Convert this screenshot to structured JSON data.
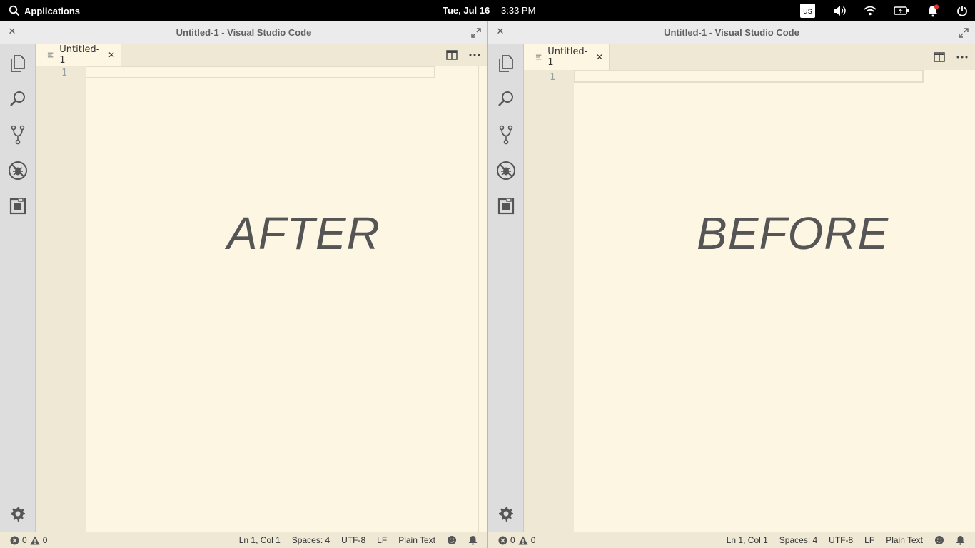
{
  "topbar": {
    "apps_label": "Applications",
    "date": "Tue, Jul 16",
    "time": "3:33 PM",
    "keyboard_layout": "us"
  },
  "left_window": {
    "title": "Untitled-1 - Visual Studio Code",
    "tab_label": "Untitled-1",
    "line_number": "1",
    "overlay_text": "AFTER",
    "status": {
      "errors": "0",
      "warnings": "0",
      "position": "Ln 1, Col 1",
      "spaces": "Spaces: 4",
      "encoding": "UTF-8",
      "eol": "LF",
      "language": "Plain Text"
    }
  },
  "right_window": {
    "title": "Untitled-1 - Visual Studio Code",
    "tab_label": "Untitled-1",
    "line_number": "1",
    "overlay_text": "BEFORE",
    "status": {
      "errors": "0",
      "warnings": "0",
      "position": "Ln 1, Col 1",
      "spaces": "Spaces: 4",
      "encoding": "UTF-8",
      "eol": "LF",
      "language": "Plain Text"
    }
  },
  "theme": {
    "editor_bg": "#fdf6e3",
    "gutter_bg": "#eee8d5",
    "activity_bg": "#dddddd",
    "icon_color": "#555555"
  },
  "icons": [
    "search-icon",
    "volume-icon",
    "wifi-icon",
    "battery-icon",
    "notification-icon",
    "power-icon",
    "explorer-icon",
    "source-control-icon",
    "debug-icon",
    "extensions-icon",
    "gear-icon",
    "split-editor-icon",
    "more-actions-icon",
    "maximize-icon",
    "close-icon",
    "error-icon",
    "warning-icon",
    "smiley-icon",
    "bell-icon"
  ]
}
